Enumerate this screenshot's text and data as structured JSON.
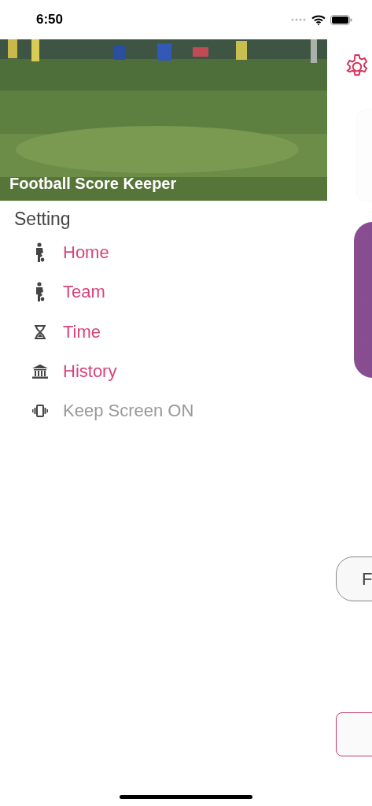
{
  "status_bar": {
    "time": "6:50"
  },
  "drawer": {
    "title": "Football Score Keeper",
    "section": "Setting",
    "items": [
      {
        "label": "Home",
        "kind": "player",
        "disabled": false
      },
      {
        "label": "Team",
        "kind": "player",
        "disabled": false
      },
      {
        "label": "Time",
        "kind": "hourglass",
        "disabled": false
      },
      {
        "label": "History",
        "kind": "museum",
        "disabled": false
      },
      {
        "label": "Keep Screen ON",
        "kind": "vibrate",
        "disabled": true
      }
    ]
  },
  "main": {
    "button_label": "F"
  }
}
